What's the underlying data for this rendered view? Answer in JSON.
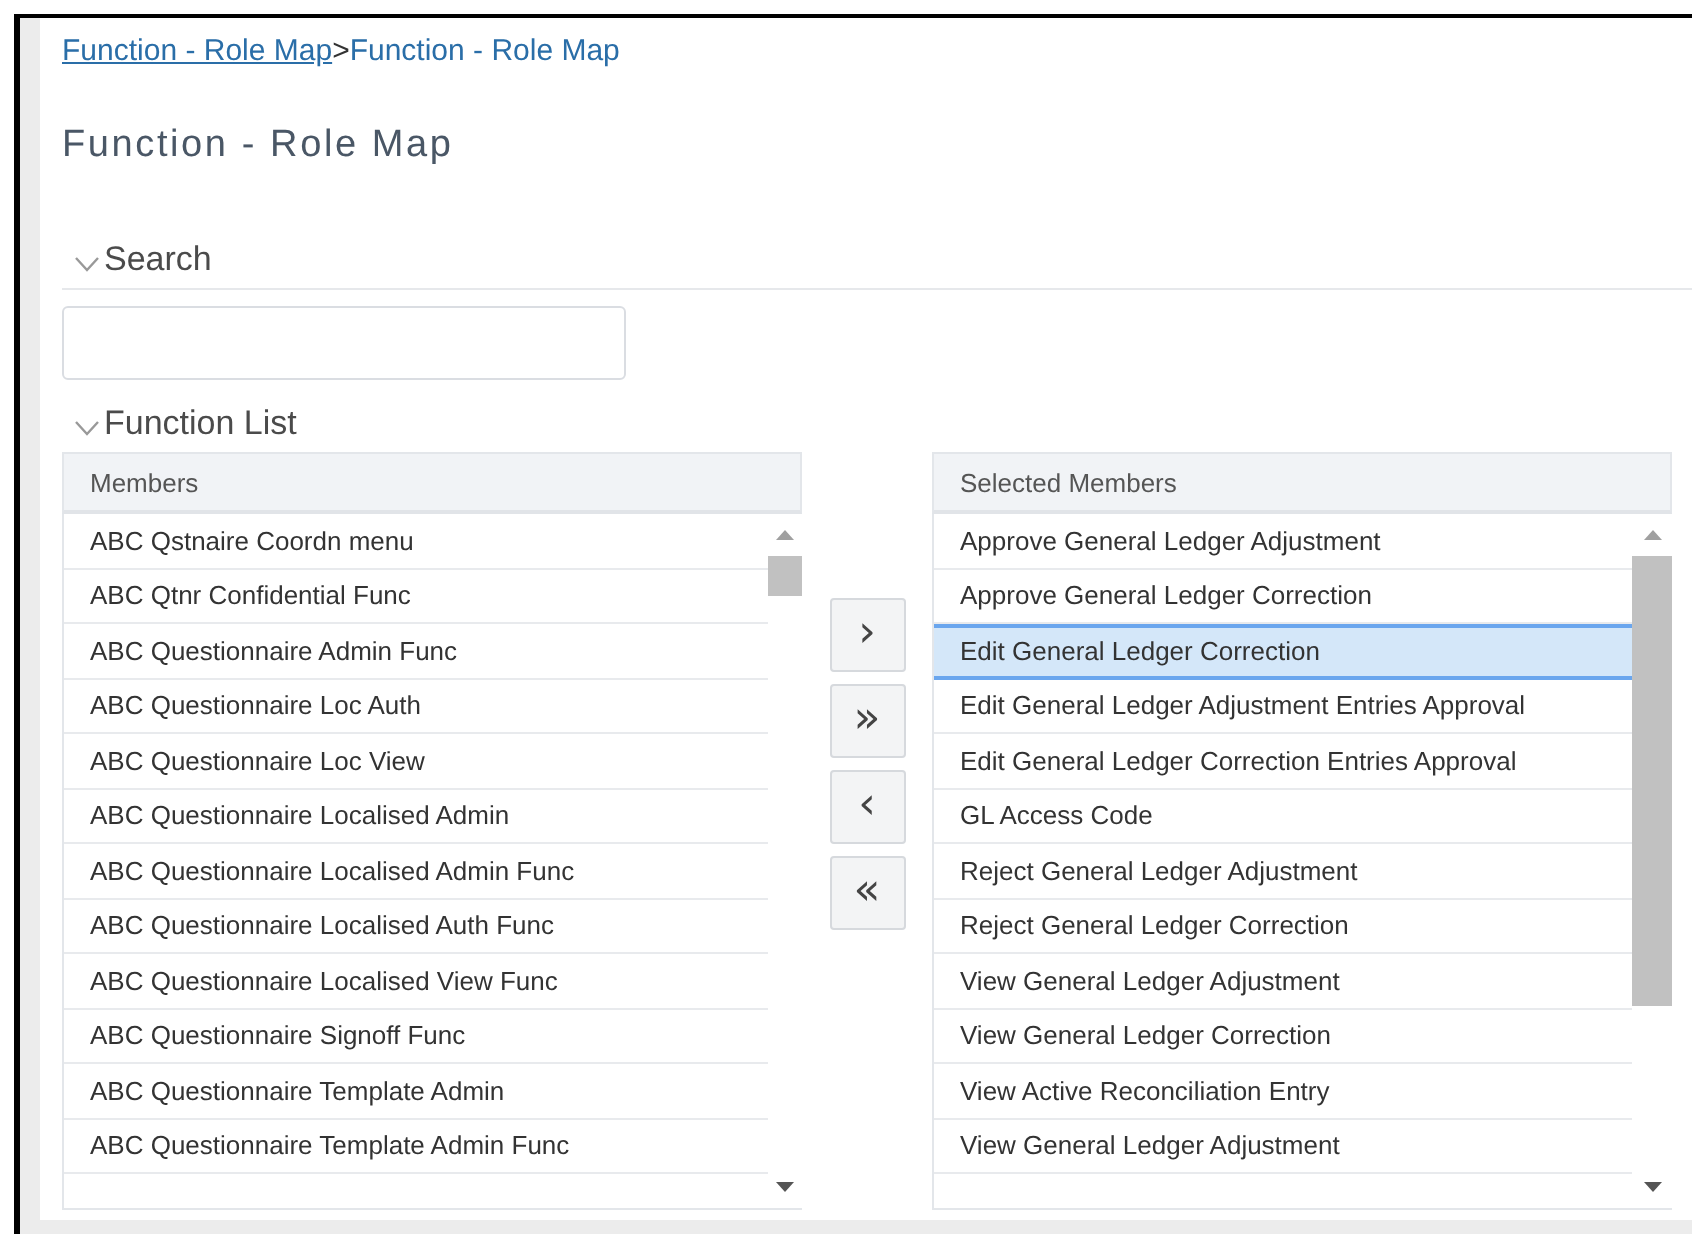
{
  "breadcrumb": {
    "link": "Function - Role Map",
    "separator": ">",
    "current": "Function - Role Map"
  },
  "title": "Function - Role Map",
  "search": {
    "heading": "Search",
    "expanded": true
  },
  "function_list": {
    "heading": "Function List",
    "expanded": true
  },
  "members": {
    "header": "Members",
    "items": [
      {
        "label": "ABC Qstnaire Coordn menu",
        "selected": false
      },
      {
        "label": "ABC Qtnr Confidential Func",
        "selected": false
      },
      {
        "label": "ABC Questionnaire Admin Func",
        "selected": false
      },
      {
        "label": "ABC Questionnaire Loc Auth",
        "selected": false
      },
      {
        "label": "ABC Questionnaire Loc View",
        "selected": false
      },
      {
        "label": "ABC Questionnaire Localised Admin",
        "selected": false
      },
      {
        "label": "ABC Questionnaire Localised Admin Func",
        "selected": false
      },
      {
        "label": "ABC Questionnaire Localised Auth Func",
        "selected": false
      },
      {
        "label": "ABC Questionnaire Localised View Func",
        "selected": false
      },
      {
        "label": "ABC Questionnaire Signoff Func",
        "selected": false
      },
      {
        "label": "ABC Questionnaire Template Admin",
        "selected": false
      },
      {
        "label": "ABC Questionnaire Template Admin Func",
        "selected": false
      }
    ]
  },
  "transfer_buttons": [
    {
      "label": "›"
    },
    {
      "label": "»"
    },
    {
      "label": "‹"
    },
    {
      "label": "«"
    }
  ],
  "selected_members": {
    "header": "Selected Members",
    "items": [
      {
        "label": "Approve General Ledger Adjustment",
        "selected": false
      },
      {
        "label": "Approve General Ledger Correction",
        "selected": false
      },
      {
        "label": "Edit General Ledger Correction",
        "selected": true
      },
      {
        "label": "Edit General Ledger Adjustment Entries Approval",
        "selected": false
      },
      {
        "label": "Edit General Ledger Correction Entries Approval",
        "selected": false
      },
      {
        "label": "GL Access Code",
        "selected": false
      },
      {
        "label": "Reject General Ledger Adjustment",
        "selected": false
      },
      {
        "label": "Reject General Ledger Correction",
        "selected": false
      },
      {
        "label": "View General Ledger Adjustment",
        "selected": false
      },
      {
        "label": "View General Ledger Correction",
        "selected": false
      },
      {
        "label": "View Active Reconciliation Entry",
        "selected": false
      },
      {
        "label": "View General Ledger Adjustment",
        "selected": false
      }
    ]
  }
}
